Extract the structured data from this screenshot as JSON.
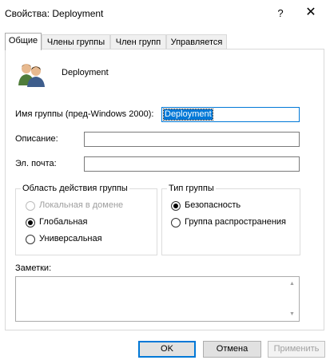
{
  "window": {
    "title": "Свойства: Deployment",
    "help_glyph": "?",
    "close_glyph": "✕"
  },
  "tabs": [
    {
      "label": "Общие"
    },
    {
      "label": "Члены группы"
    },
    {
      "label": "Член групп"
    },
    {
      "label": "Управляется"
    }
  ],
  "general": {
    "group_name": "Deployment",
    "pre2000_label": "Имя группы (пред-Windows 2000):",
    "pre2000_value": "Deployment",
    "description_label": "Описание:",
    "description_value": "",
    "email_label": "Эл. почта:",
    "email_value": ""
  },
  "scope": {
    "title": "Область действия группы",
    "options": [
      {
        "label": "Локальная в домене",
        "state": "disabled"
      },
      {
        "label": "Глобальная",
        "state": "checked"
      },
      {
        "label": "Универсальная",
        "state": "unchecked"
      }
    ]
  },
  "type": {
    "title": "Тип группы",
    "options": [
      {
        "label": "Безопасность",
        "state": "checked"
      },
      {
        "label": "Группа распространения",
        "state": "unchecked"
      }
    ]
  },
  "notes": {
    "label": "Заметки:",
    "value": ""
  },
  "buttons": {
    "ok": "OK",
    "cancel": "Отмена",
    "apply": "Применить"
  }
}
